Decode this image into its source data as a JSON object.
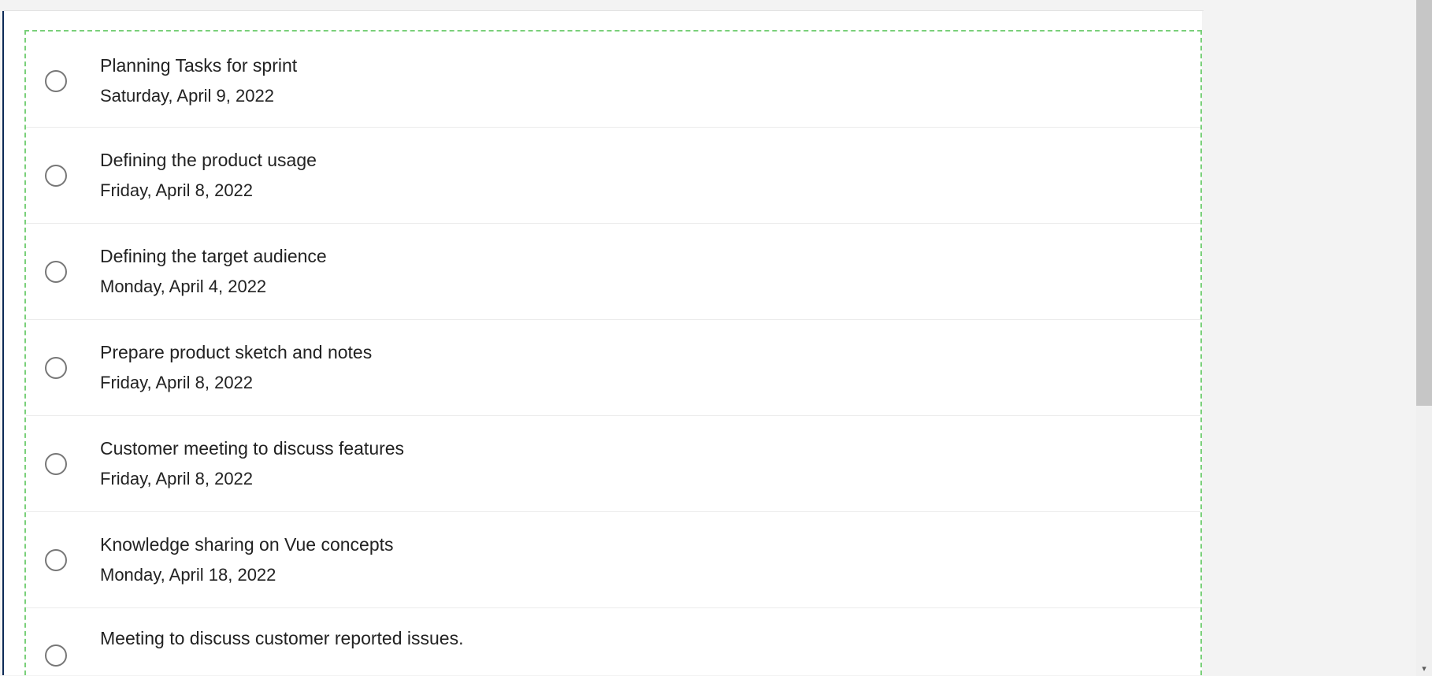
{
  "tasks": [
    {
      "title": "Planning Tasks for sprint",
      "date": "Saturday, April 9, 2022"
    },
    {
      "title": "Defining the product usage",
      "date": "Friday, April 8, 2022"
    },
    {
      "title": "Defining the target audience",
      "date": "Monday, April 4, 2022"
    },
    {
      "title": "Prepare product sketch and notes",
      "date": "Friday, April 8, 2022"
    },
    {
      "title": "Customer meeting to discuss features",
      "date": "Friday, April 8, 2022"
    },
    {
      "title": "Knowledge sharing on Vue concepts",
      "date": "Monday, April 18, 2022"
    },
    {
      "title": "Meeting to discuss customer reported issues.",
      "date": ""
    }
  ],
  "scroll_arrow": "▾"
}
